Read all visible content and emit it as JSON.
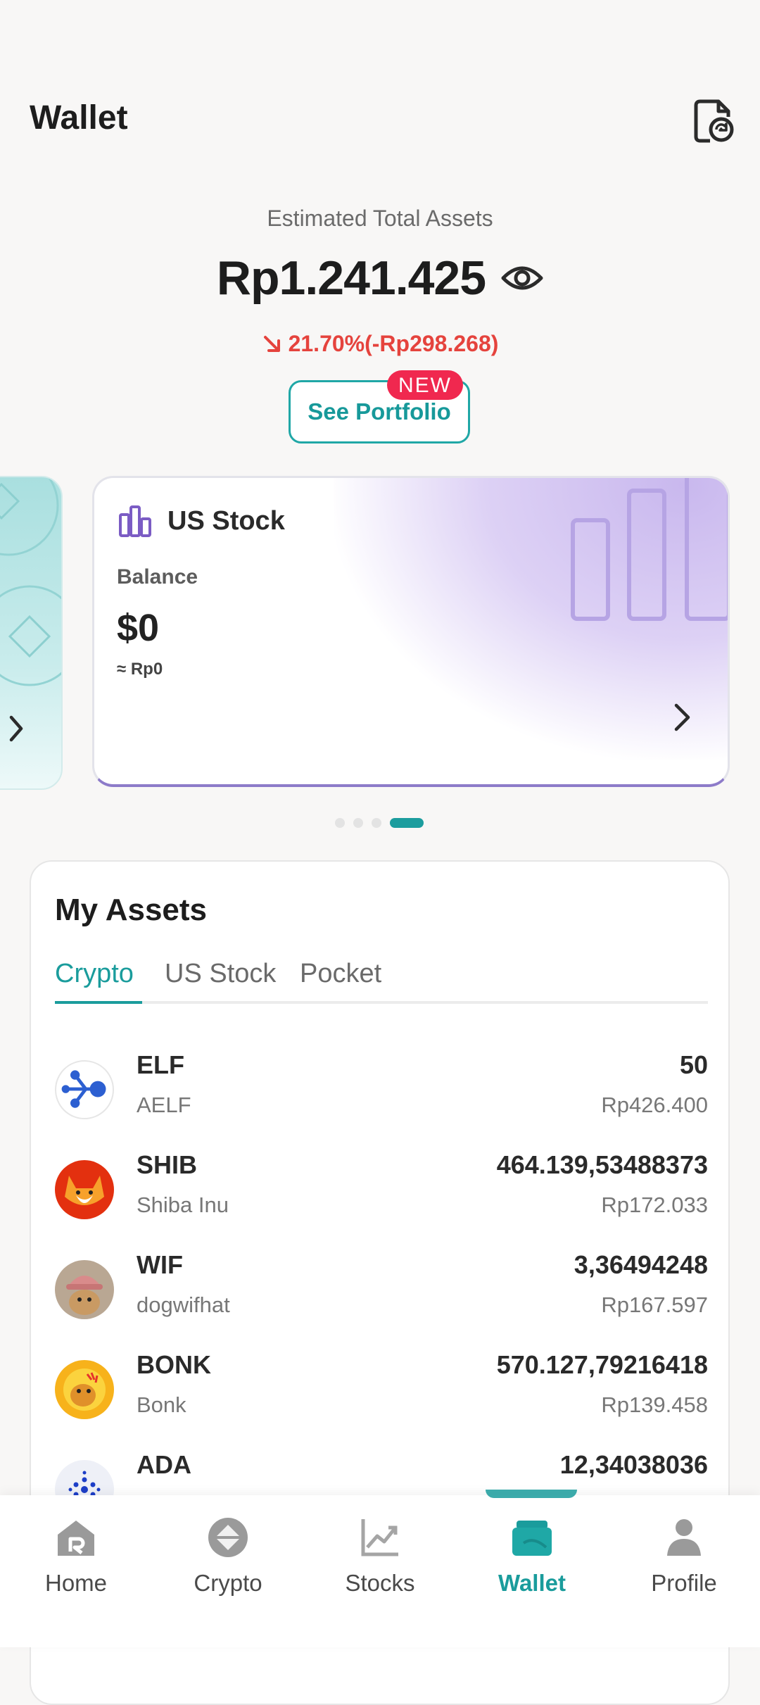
{
  "header": {
    "title": "Wallet"
  },
  "totals": {
    "label": "Estimated Total Assets",
    "value": "Rp1.241.425",
    "change": "21.70%(-Rp298.268)"
  },
  "portfolio": {
    "button_label": "See Portfolio",
    "badge": "NEW"
  },
  "card": {
    "title": "US Stock",
    "balance_label": "Balance",
    "balance": "$0",
    "approx": "≈ Rp0"
  },
  "carousel": {
    "total": 4,
    "active_index": 3
  },
  "assets": {
    "title": "My Assets",
    "tabs": [
      {
        "label": "Crypto",
        "active": true
      },
      {
        "label": "US Stock",
        "active": false
      },
      {
        "label": "Pocket",
        "active": false
      }
    ],
    "rows": [
      {
        "symbol": "ELF",
        "name": "AELF",
        "amount": "50",
        "value": "Rp426.400",
        "icon": "aelf-logo-icon"
      },
      {
        "symbol": "SHIB",
        "name": "Shiba Inu",
        "amount": "464.139,53488373",
        "value": "Rp172.033",
        "icon": "shiba-inu-logo-icon"
      },
      {
        "symbol": "WIF",
        "name": "dogwifhat",
        "amount": "3,36494248",
        "value": "Rp167.597",
        "icon": "dogwifhat-logo-icon"
      },
      {
        "symbol": "BONK",
        "name": "Bonk",
        "amount": "570.127,79216418",
        "value": "Rp139.458",
        "icon": "bonk-logo-icon"
      },
      {
        "symbol": "ADA",
        "name": "",
        "amount": "12,34038036",
        "value": "",
        "icon": "cardano-logo-icon"
      }
    ]
  },
  "nav": {
    "items": [
      {
        "label": "Home",
        "icon": "home-icon",
        "active": false
      },
      {
        "label": "Crypto",
        "icon": "crypto-icon",
        "active": false
      },
      {
        "label": "Stocks",
        "icon": "stocks-icon",
        "active": false
      },
      {
        "label": "Wallet",
        "icon": "wallet-icon",
        "active": true
      },
      {
        "label": "Profile",
        "icon": "profile-icon",
        "active": false
      }
    ]
  },
  "colors": {
    "accent": "#1a9c9c",
    "negative": "#e5433d",
    "badge": "#f0284f",
    "stock_purple": "#7b5cc4"
  }
}
